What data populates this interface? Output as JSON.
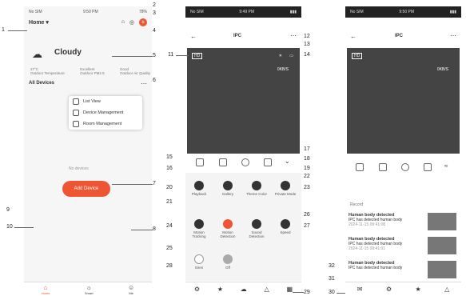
{
  "phone1": {
    "status": "No SIM",
    "time": "9:50 PM",
    "battery": "78%",
    "home_label": "Home",
    "weather": "Cloudy",
    "stats": [
      {
        "value": "27°C",
        "label": "Outdoor Temperature"
      },
      {
        "value": "Excellent",
        "label": "Outdoor PM2.5"
      },
      {
        "value": "Good",
        "label": "Outdoor Air Quality"
      }
    ],
    "tab": "All Devices",
    "menu": [
      "List View",
      "Device Management",
      "Room Management"
    ],
    "no_device": "No devices",
    "add_device": "Add Device",
    "nav": [
      "Home",
      "Smart",
      "Me"
    ]
  },
  "phone2": {
    "status": "No SIM",
    "time": "9:49 PM",
    "title": "IPC",
    "hd": "HD",
    "speed": "0KB/S",
    "tools": [
      "screenshot",
      "snapshot",
      "microphone",
      "record",
      "more"
    ],
    "functions": [
      "Playback",
      "Gallery",
      "Theme Color",
      "Private Mode",
      "Motion Tracking",
      "Motion Detection",
      "Sound Detection",
      "Speed",
      "Siren",
      "Off"
    ]
  },
  "phone3": {
    "status": "No SIM",
    "time": "9:50 PM",
    "title": "IPC",
    "hd": "HD",
    "speed": "0KB/S",
    "section": "Record",
    "events": [
      {
        "title": "Human body detected",
        "desc": "IPC has detected human body",
        "time": "2024-11-15 09:41:08"
      },
      {
        "title": "Human body detected",
        "desc": "IPC has detected human body",
        "time": "2024-11-15 09:41:01"
      },
      {
        "title": "Human body detected",
        "desc": "IPC has detected human body",
        "time": "2024-11-15 09:40:52"
      }
    ]
  },
  "callouts": [
    "1",
    "2",
    "3",
    "4",
    "5",
    "6",
    "7",
    "8",
    "9",
    "10",
    "11",
    "12",
    "13",
    "14",
    "15",
    "16",
    "17",
    "18",
    "19",
    "20",
    "21",
    "22",
    "23",
    "24",
    "25",
    "26",
    "27",
    "28",
    "29",
    "30",
    "31",
    "32"
  ],
  "colors": {
    "accent": "#ee5533",
    "video": "#444444"
  }
}
